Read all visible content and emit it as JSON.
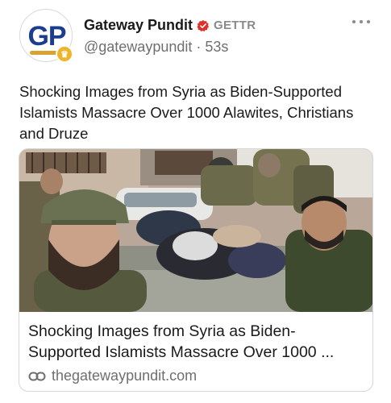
{
  "author": {
    "display_name": "Gateway Pundit",
    "platform": "GETTR",
    "handle": "@gatewaypundit",
    "separator": "·",
    "time_ago": "53s",
    "avatar_text": "GP",
    "verified_icon": "verified-badge-icon"
  },
  "post": {
    "text": "Shocking Images from Syria as Biden-Supported Islamists Massacre Over 1000 Alawites, Christians and Druze"
  },
  "link_card": {
    "title": "Shocking Images from Syria as Biden-Supported Islamists Massacre Over 1000 ...",
    "domain": "thegatewaypundit.com",
    "link_icon": "link-icon"
  },
  "menu": {
    "icon": "more-options-icon"
  },
  "colors": {
    "verified_red": "#e0302a",
    "gp_blue": "#1b3d8f",
    "gold": "#f0b429",
    "muted_text": "#6f6f6f"
  }
}
